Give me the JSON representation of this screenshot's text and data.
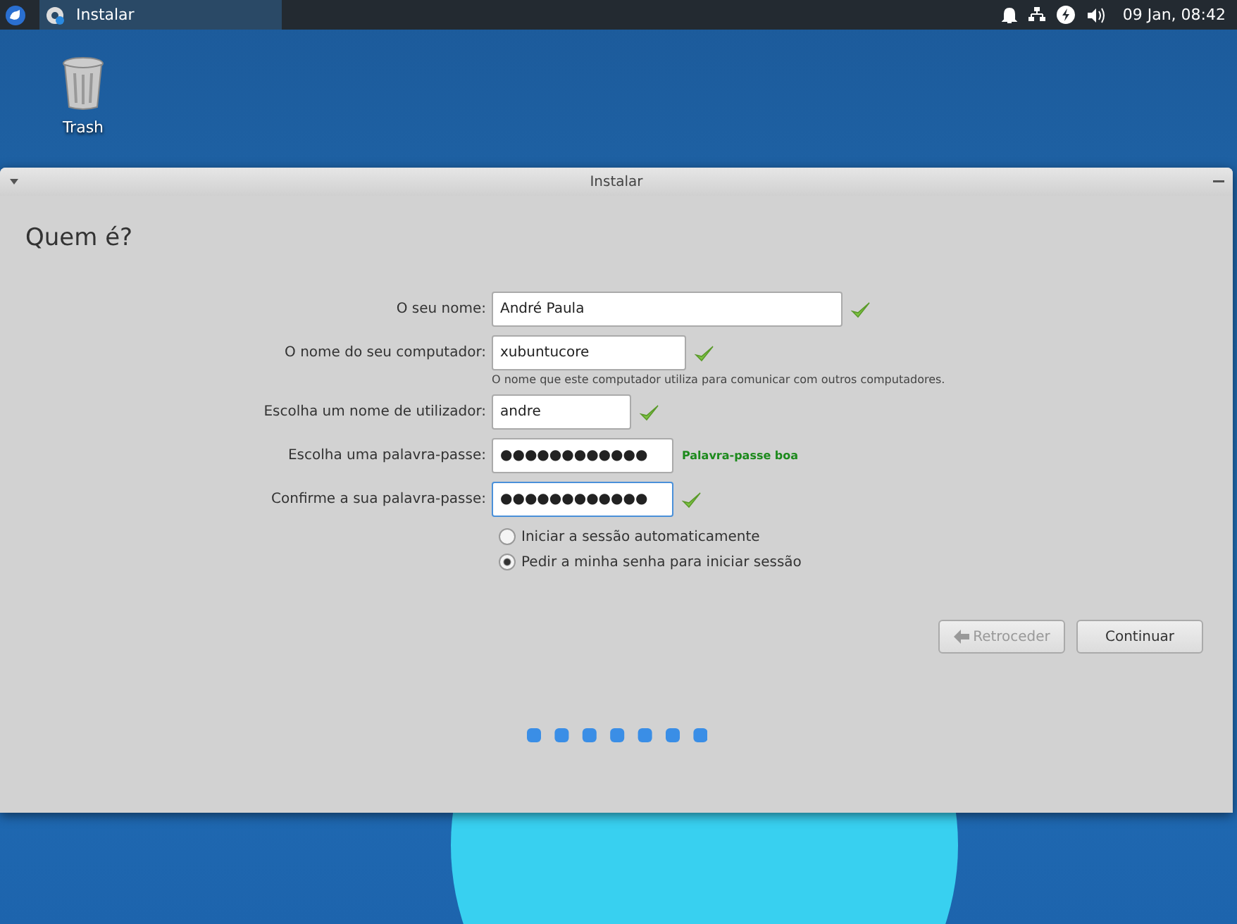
{
  "panel": {
    "task": {
      "title": "Instalar"
    },
    "clock": "09 Jan, 08:42"
  },
  "desktop": {
    "icons": [
      {
        "label": "Trash"
      }
    ]
  },
  "window": {
    "title": "Instalar",
    "heading": "Quem é?",
    "fields": [
      {
        "label": "O seu nome:",
        "value": "André Paula",
        "valid": true,
        "focused": false
      },
      {
        "label": "O nome do seu computador:",
        "value": "xubuntucore",
        "valid": true,
        "focused": false,
        "hint": "O nome que este computador utiliza para comunicar com outros computadores."
      },
      {
        "label": "Escolha um nome de utilizador:",
        "value": "andre",
        "valid": true,
        "focused": false
      },
      {
        "label": "Escolha uma palavra-passe:",
        "value": "●●●●●●●●●●●●",
        "valid": false,
        "focused": false,
        "strength": "Palavra-passe boa"
      },
      {
        "label": "Confirme a sua palavra-passe:",
        "value": "●●●●●●●●●●●●",
        "valid": true,
        "focused": true
      }
    ],
    "login_options": [
      {
        "label": "Iniciar a sessão automaticamente",
        "selected": false
      },
      {
        "label": "Pedir a minha senha para iniciar sessão",
        "selected": true
      }
    ],
    "buttons": [
      {
        "label": "Retroceder",
        "disabled": true,
        "kind": "back"
      },
      {
        "label": "Continuar",
        "disabled": false,
        "kind": "next"
      }
    ]
  }
}
